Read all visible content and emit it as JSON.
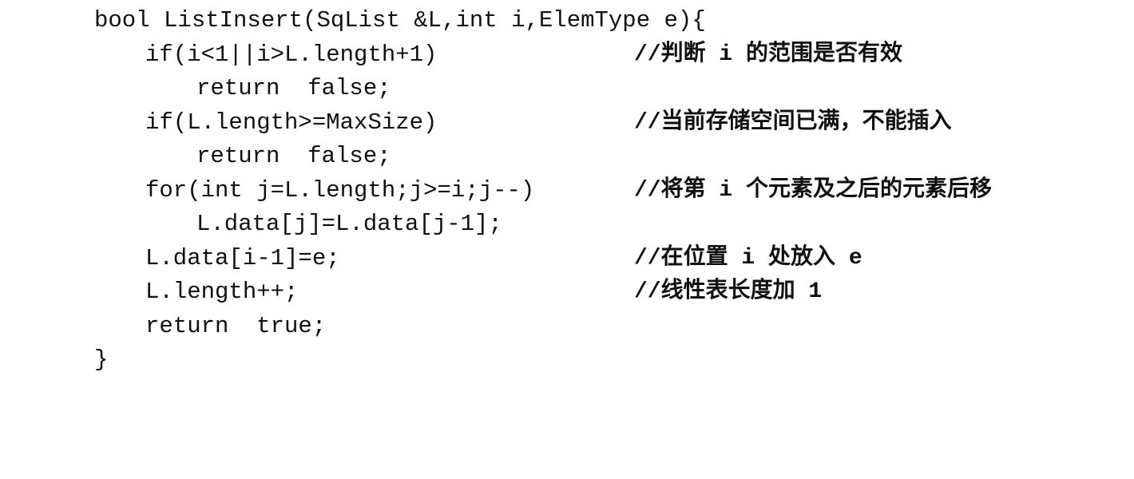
{
  "code": {
    "lines": [
      {
        "code": "bool ListInsert(SqList &L,int i,ElemType e){",
        "comment": ""
      },
      {
        "code": "if(i<1||i>L.length+1)",
        "comment": "//判断 i 的范围是否有效"
      },
      {
        "code": "return  false;",
        "comment": ""
      },
      {
        "code": "if(L.length>=MaxSize)",
        "comment": "//当前存储空间已满，不能插入"
      },
      {
        "code": "return  false;",
        "comment": ""
      },
      {
        "code": "for(int j=L.length;j>=i;j--)",
        "comment": "//将第 i 个元素及之后的元素后移"
      },
      {
        "code": "L.data[j]=L.data[j-1];",
        "comment": ""
      },
      {
        "code": "L.data[i-1]=e;",
        "comment": "//在位置 i 处放入 e"
      },
      {
        "code": "L.length++;",
        "comment": "//线性表长度加 1"
      },
      {
        "code": "return  true;",
        "comment": ""
      },
      {
        "code": "}",
        "comment": ""
      }
    ]
  }
}
